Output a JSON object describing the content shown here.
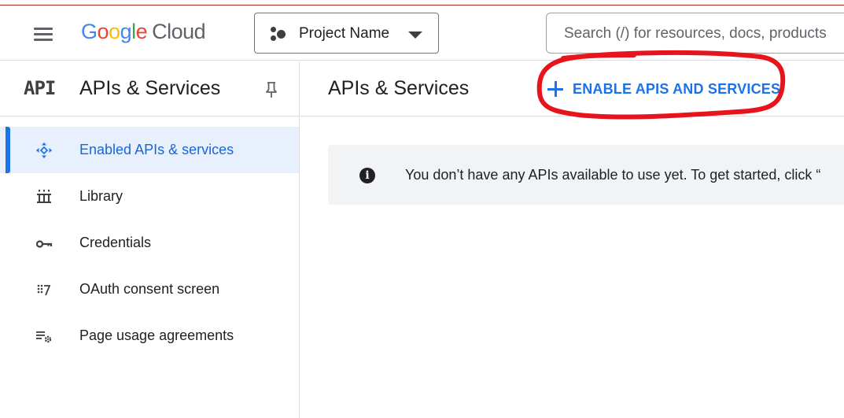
{
  "header": {
    "logo": {
      "G1": "G",
      "o1": "o",
      "o2": "o",
      "g": "g",
      "l": "l",
      "e": "e",
      "cloud": "Cloud"
    },
    "project_selector": {
      "label": "Project Name"
    },
    "search": {
      "placeholder": "Search (/) for resources, docs, products"
    }
  },
  "sidebar": {
    "api_mark": "API",
    "title": "APIs & Services",
    "items": [
      {
        "label": "Enabled APIs & services",
        "icon": "enabled-apis-icon",
        "active": true
      },
      {
        "label": "Library",
        "icon": "library-icon",
        "active": false
      },
      {
        "label": "Credentials",
        "icon": "key-icon",
        "active": false
      },
      {
        "label": "OAuth consent screen",
        "icon": "oauth-consent-icon",
        "active": false
      },
      {
        "label": "Page usage agreements",
        "icon": "page-usage-settings-icon",
        "active": false
      }
    ]
  },
  "main": {
    "title": "APIs & Services",
    "enable_button": "ENABLE APIS AND SERVICES",
    "info_banner": "You don’t have any APIs available to use yet. To get started, click “"
  },
  "colors": {
    "accent_blue": "#1a73e8",
    "active_bg": "#e8f0fe",
    "annotation_red": "#e8141c",
    "banner_bg": "#f1f3f4"
  }
}
